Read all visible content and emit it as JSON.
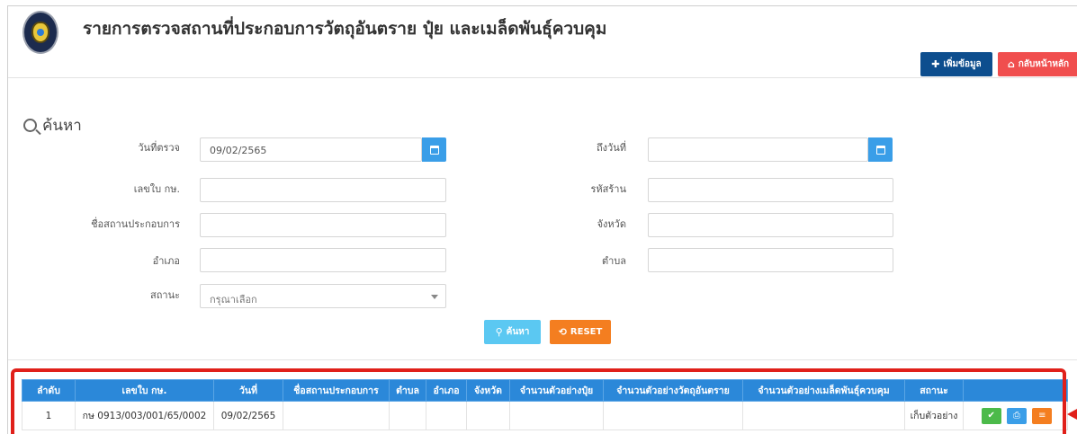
{
  "header": {
    "title": "รายการตรวจสถานที่ประกอบการวัตถุอันตราย ปุ๋ย และเมล็ดพันธุ์ควบคุม",
    "add_button": "เพิ่มข้อมูล",
    "home_button": "กลับหน้าหลัก"
  },
  "search": {
    "heading": "ค้นหา",
    "fields": {
      "date_from": {
        "label": "วันที่ตรวจ",
        "value": "09/02/2565"
      },
      "date_to": {
        "label": "ถึงวันที่",
        "value": ""
      },
      "license_no": {
        "label": "เลขใบ กษ.",
        "value": ""
      },
      "shop_code": {
        "label": "รหัสร้าน",
        "value": ""
      },
      "business_name": {
        "label": "ชื่อสถานประกอบการ",
        "value": ""
      },
      "province": {
        "label": "จังหวัด",
        "value": ""
      },
      "district": {
        "label": "อำเภอ",
        "value": ""
      },
      "subdistrict": {
        "label": "ตำบล",
        "value": ""
      },
      "status": {
        "label": "สถานะ",
        "placeholder": "กรุณาเลือก"
      }
    },
    "search_button": "ค้นหา",
    "reset_button": "RESET"
  },
  "table": {
    "columns": [
      "ลำดับ",
      "เลขใบ กษ.",
      "วันที่",
      "ชื่อสถานประกอบการ",
      "ตำบล",
      "อำเภอ",
      "จังหวัด",
      "จำนวนตัวอย่างปุ๋ย",
      "จำนวนตัวอย่างวัตถุอันตราย",
      "จำนวนตัวอย่างเมล็ดพันธุ์ควบคุม",
      "สถานะ",
      ""
    ],
    "rows": [
      {
        "no": "1",
        "license": "กษ 0913/003/001/65/0002",
        "date": "09/02/2565",
        "business": "",
        "subdistrict": "",
        "district": "",
        "province": "",
        "fertilizer_samples": "",
        "hazard_samples": "",
        "seed_samples": "",
        "status": "เก็บตัวอย่าง"
      }
    ]
  },
  "icons": {
    "add": "plus-icon",
    "home": "home-icon",
    "search": "search-icon",
    "calendar": "calendar-icon",
    "approve": "check-icon",
    "print": "print-icon",
    "list": "list-icon"
  },
  "colors": {
    "primary_dark": "#0d4e8e",
    "danger": "#f04e4e",
    "table_header": "#2b88d9",
    "search_button": "#5bc8f2",
    "reset_button": "#f47e20",
    "highlight_frame": "#e0201a"
  }
}
